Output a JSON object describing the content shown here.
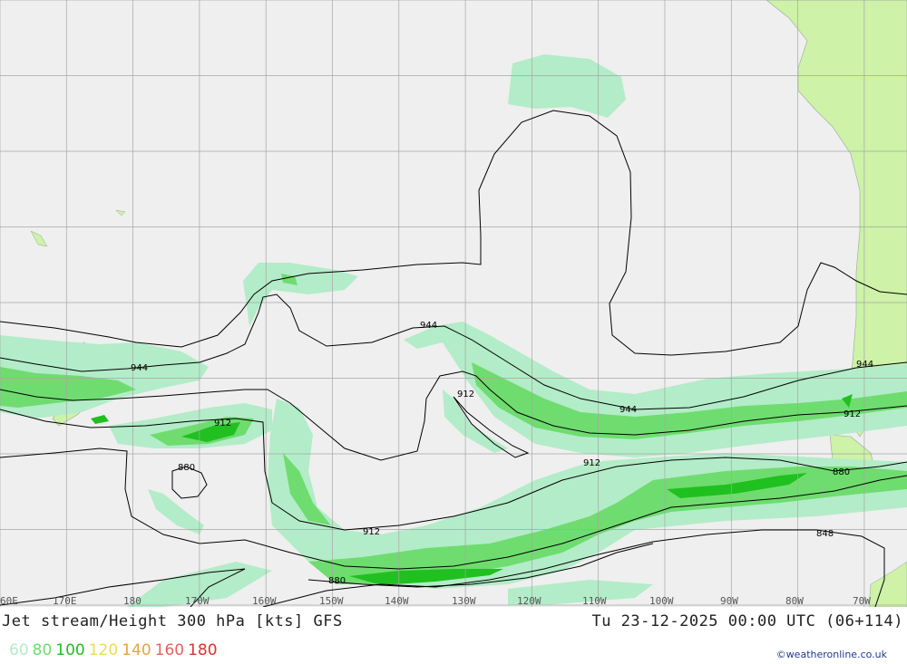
{
  "map": {
    "title": "Jet stream/Height 300 hPa [kts] GFS",
    "datetime": "Tu 23-12-2025 00:00 UTC (06+114)",
    "credit": "©weatheronline.co.uk",
    "lon_labels": [
      "60E",
      "170E",
      "180",
      "170W",
      "160W",
      "150W",
      "140W",
      "130W",
      "120W",
      "110W",
      "100W",
      "90W",
      "80W",
      "70W"
    ],
    "contour_labels": [
      {
        "text": "944"
      },
      {
        "text": "944"
      },
      {
        "text": "944"
      },
      {
        "text": "944"
      },
      {
        "text": "912"
      },
      {
        "text": "912"
      },
      {
        "text": "912"
      },
      {
        "text": "912"
      },
      {
        "text": "912"
      },
      {
        "text": "880"
      },
      {
        "text": "880"
      },
      {
        "text": "880"
      },
      {
        "text": "848"
      }
    ],
    "legend": [
      {
        "label": "60",
        "color": "#b3ecc8"
      },
      {
        "label": "80",
        "color": "#6fdc6f"
      },
      {
        "label": "100",
        "color": "#20c020"
      },
      {
        "label": "120",
        "color": "#e8e04a"
      },
      {
        "label": "140",
        "color": "#e8a440"
      },
      {
        "label": "160",
        "color": "#e86060"
      },
      {
        "label": "180",
        "color": "#e03030"
      }
    ],
    "colors": {
      "ocean": "#efefef",
      "land": "#cdf2a8",
      "grid": "#a6a6a6",
      "contour": "#000000"
    }
  }
}
